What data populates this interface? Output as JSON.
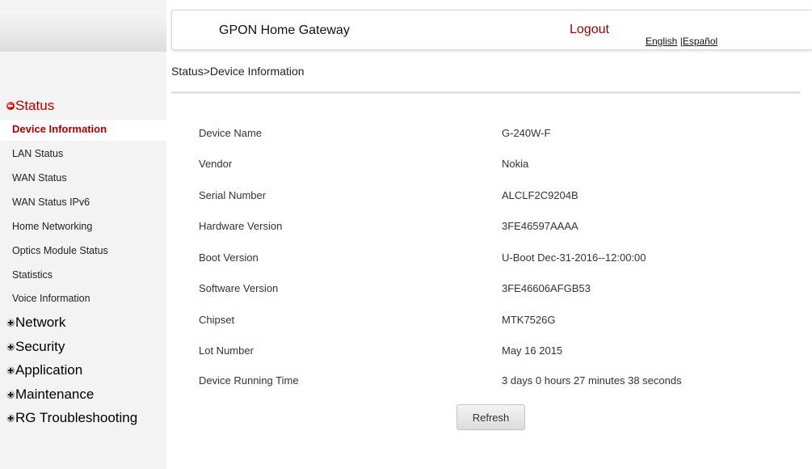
{
  "header": {
    "title": "GPON Home Gateway",
    "logout": "Logout",
    "lang_english": "English",
    "lang_separator": " |",
    "lang_spanish": "Español"
  },
  "breadcrumb": "Status>Device Information",
  "sidebar": {
    "groups": [
      {
        "label": "Status",
        "icon": "minus-ball-icon",
        "expanded": true
      },
      {
        "label": "Network",
        "icon": "plus-ball-icon",
        "expanded": false
      },
      {
        "label": "Security",
        "icon": "plus-ball-icon",
        "expanded": false
      },
      {
        "label": "Application",
        "icon": "plus-ball-icon",
        "expanded": false
      },
      {
        "label": "Maintenance",
        "icon": "plus-ball-icon",
        "expanded": false
      },
      {
        "label": "RG Troubleshooting",
        "icon": "plus-ball-icon",
        "expanded": false
      }
    ],
    "status_items": [
      "Device Information",
      "LAN Status",
      "WAN Status",
      "WAN Status IPv6",
      "Home Networking",
      "Optics Module Status",
      "Statistics",
      "Voice Information"
    ],
    "active_item": "Device Information"
  },
  "device_info": [
    {
      "label": "Device Name",
      "value": "G-240W-F"
    },
    {
      "label": "Vendor",
      "value": "Nokia"
    },
    {
      "label": "Serial Number",
      "value": "ALCLF2C9204B"
    },
    {
      "label": "Hardware Version",
      "value": "3FE46597AAAA"
    },
    {
      "label": "Boot Version",
      "value": "U-Boot Dec-31-2016--12:00:00"
    },
    {
      "label": "Software Version",
      "value": "3FE46606AFGB53"
    },
    {
      "label": "Chipset",
      "value": "MTK7526G"
    },
    {
      "label": "Lot Number",
      "value": "May 16 2015"
    },
    {
      "label": "Device Running Time",
      "value": "3 days 0 hours 27 minutes 38 seconds"
    }
  ],
  "refresh_label": "Refresh",
  "colors": {
    "accent": "#b00000",
    "sidebar_bg": "#f3f3f3"
  }
}
